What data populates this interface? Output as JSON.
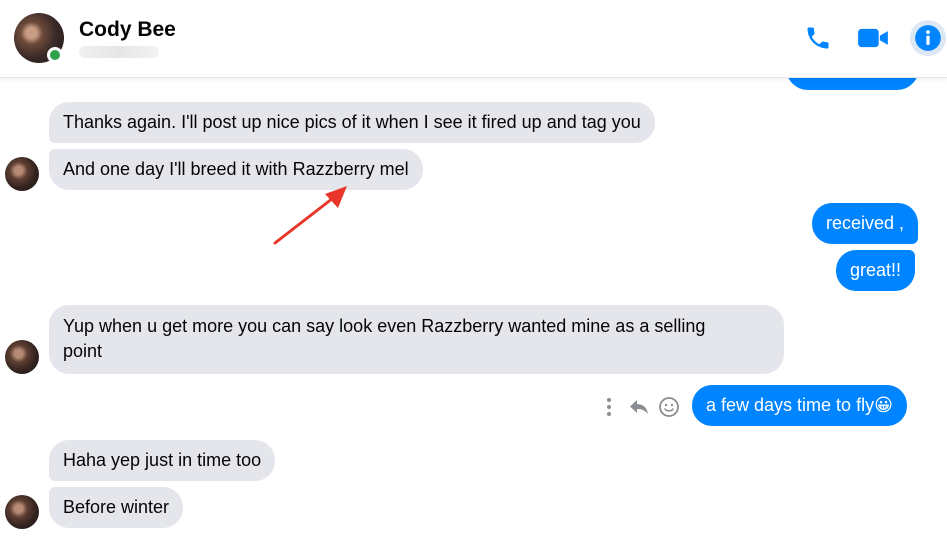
{
  "header": {
    "name": "Cody Bee",
    "icons": {
      "call": "phone-icon",
      "video": "video-camera-icon",
      "info": "info-icon"
    },
    "accent_color": "#0084ff"
  },
  "messages": [
    {
      "direction": "incoming",
      "text": "Thanks again. I'll post up nice pics of it when I see it fired up and tag you"
    },
    {
      "direction": "incoming",
      "text": "And one day I'll breed it with Razzberry mel"
    },
    {
      "direction": "outgoing",
      "text": "received ,"
    },
    {
      "direction": "outgoing",
      "text": "great!!"
    },
    {
      "direction": "incoming",
      "line1": "Yup when u get more you can say look even Razzberry wanted mine as a selling",
      "line2": "point"
    },
    {
      "direction": "outgoing",
      "text": "a few days time to fly",
      "emoji": "😀"
    },
    {
      "direction": "incoming",
      "text": "Haha yep just in time too"
    },
    {
      "direction": "incoming",
      "text": "Before winter"
    }
  ],
  "message_actions": {
    "icons": [
      "more-options-icon",
      "reply-icon",
      "react-icon"
    ]
  },
  "annotation": {
    "type": "arrow",
    "color": "#e8362b"
  },
  "colors": {
    "incoming_bubble": "#e4e6eb",
    "outgoing_bubble": "#0084ff",
    "online": "#31a24c"
  }
}
